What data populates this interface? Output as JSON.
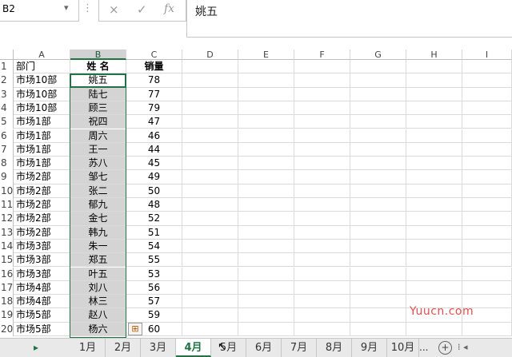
{
  "name_box": {
    "value": "B2"
  },
  "formula_bar": {
    "cancel_icon": "×",
    "enter_icon": "✓",
    "fx_label": "fx",
    "content": "姚五"
  },
  "columns": [
    "A",
    "B",
    "C",
    "D",
    "E",
    "F",
    "G",
    "H",
    "I"
  ],
  "headers": {
    "dept": "部门",
    "name": "姓 名",
    "sales": "销量"
  },
  "rows": [
    {
      "num": "2",
      "dept": "市场10部",
      "name": "姚五",
      "sales": "78"
    },
    {
      "num": "3",
      "dept": "市场10部",
      "name": "陆七",
      "sales": "77"
    },
    {
      "num": "4",
      "dept": "市场10部",
      "name": "顾三",
      "sales": "79"
    },
    {
      "num": "5",
      "dept": "市场1部",
      "name": "祝四",
      "sales": "47"
    },
    {
      "num": "6",
      "dept": "市场1部",
      "name": "周六",
      "sales": "46"
    },
    {
      "num": "7",
      "dept": "市场1部",
      "name": "王一",
      "sales": "44"
    },
    {
      "num": "8",
      "dept": "市场1部",
      "name": "苏八",
      "sales": "45"
    },
    {
      "num": "9",
      "dept": "市场2部",
      "name": "邹七",
      "sales": "49"
    },
    {
      "num": "10",
      "dept": "市场2部",
      "name": "张二",
      "sales": "50"
    },
    {
      "num": "11",
      "dept": "市场2部",
      "name": "郁九",
      "sales": "48"
    },
    {
      "num": "12",
      "dept": "市场2部",
      "name": "金七",
      "sales": "52"
    },
    {
      "num": "13",
      "dept": "市场2部",
      "name": "韩九",
      "sales": "51"
    },
    {
      "num": "14",
      "dept": "市场3部",
      "name": "朱一",
      "sales": "54"
    },
    {
      "num": "15",
      "dept": "市场3部",
      "name": "郑五",
      "sales": "55"
    },
    {
      "num": "16",
      "dept": "市场3部",
      "name": "叶五",
      "sales": "53"
    },
    {
      "num": "17",
      "dept": "市场4部",
      "name": "刘八",
      "sales": "56"
    },
    {
      "num": "18",
      "dept": "市场4部",
      "name": "林三",
      "sales": "57"
    },
    {
      "num": "19",
      "dept": "市场5部",
      "name": "赵八",
      "sales": "59"
    },
    {
      "num": "20",
      "dept": "市场5部",
      "name": "杨六",
      "sales": "60"
    }
  ],
  "sheet_tabs": [
    "1月",
    "2月",
    "3月",
    "4月",
    "5月",
    "6月",
    "7月",
    "8月",
    "9月",
    "10月"
  ],
  "active_tab": "4月",
  "tabs_more": "...",
  "add_sheet": "+",
  "watermark": "Yuucn.com"
}
